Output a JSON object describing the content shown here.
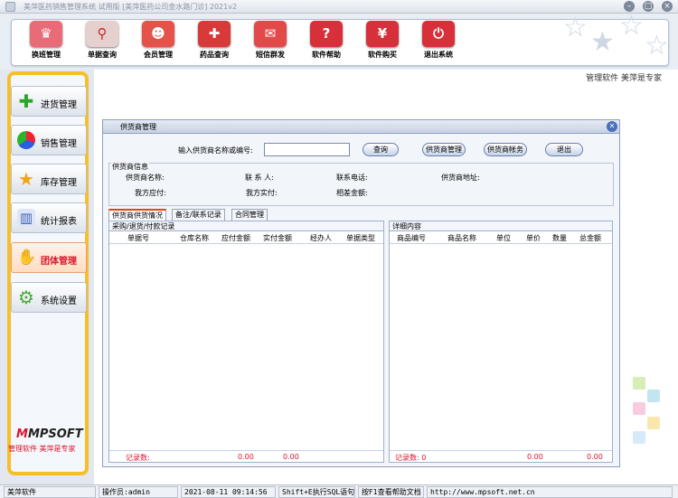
{
  "window": {
    "title": "美萍医药销售管理系统 试用版 [美萍医药公司金水路门诊] 2021v2",
    "controls": [
      "minimize-icon",
      "maximize-icon",
      "close-icon"
    ]
  },
  "toolbar": {
    "buttons": [
      {
        "label": "换班管理",
        "icon": "handover-icon",
        "color": "#e86b77"
      },
      {
        "label": "单据查询",
        "icon": "search-icon",
        "color": "#e6cfcf"
      },
      {
        "label": "会员管理",
        "icon": "member-icon",
        "color": "#e5524a"
      },
      {
        "label": "药品查询",
        "icon": "drug-icon",
        "color": "#d83a3a"
      },
      {
        "label": "短信群发",
        "icon": "sms-icon",
        "color": "#e24a4a"
      },
      {
        "label": "软件帮助",
        "icon": "help-icon",
        "color": "#d8303a"
      },
      {
        "label": "软件购买",
        "icon": "buy-icon",
        "color": "#d8303a"
      },
      {
        "label": "退出系统",
        "icon": "power-icon",
        "color": "#d8303a"
      }
    ]
  },
  "sidebar": {
    "items": [
      {
        "label": "进货管理",
        "icon": "plus-icon",
        "active": false
      },
      {
        "label": "销售管理",
        "icon": "pie-chart-icon",
        "active": false
      },
      {
        "label": "库存管理",
        "icon": "star-icon",
        "active": false
      },
      {
        "label": "统计报表",
        "icon": "bar-chart-icon",
        "active": false
      },
      {
        "label": "团体管理",
        "icon": "handshake-icon",
        "active": true
      },
      {
        "label": "系统设置",
        "icon": "gear-icon",
        "active": false
      }
    ],
    "brand_logo": "MPSOFT",
    "brand_tagline": "管理软件  美萍是专家"
  },
  "main": {
    "slogan": "管理软件  美萍是专家"
  },
  "dialog": {
    "title": "供货商管理",
    "search_label": "输入供货商名称或编号:",
    "search_value": "",
    "buttons": {
      "query": "查询",
      "supplier_mgmt": "供货商管理",
      "supplier_account": "供货商帐务",
      "exit": "退出"
    },
    "info": {
      "group_label": "供货商信息",
      "name_label": "供货商名称:",
      "contact_label": "联  系  人:",
      "phone_label": "联系电话:",
      "address_label": "供货商地址:",
      "payable_label": "我方应付:",
      "paid_label": "我方实付:",
      "diff_label": "相差金额:"
    },
    "tabs": [
      {
        "label": "供货商供货情况",
        "active": true
      },
      {
        "label": "备注/联系记录",
        "active": false
      },
      {
        "label": "合同管理",
        "active": false
      }
    ],
    "left_grid": {
      "title": "采购/退货/付款记录",
      "columns": [
        "单据号",
        "仓库名称",
        "应付金额",
        "实付金额",
        "经办人",
        "单据类型"
      ],
      "rows": [],
      "footer_label": "记录数:",
      "footer_total1": "0.00",
      "footer_total2": "0.00"
    },
    "right_grid": {
      "title": "详细内容",
      "columns": [
        "商品编号",
        "商品名称",
        "单位",
        "单价",
        "数量",
        "总金额"
      ],
      "rows": [],
      "footer_label": "记录数: 0",
      "footer_total1": "0.00",
      "footer_total2": "0.00"
    }
  },
  "statusbar": {
    "app_name": "美萍软件",
    "operator": "操作员:admin",
    "datetime": "2021-08-11 09:14:56",
    "sql_hint": "Shift+E执行SQL语句",
    "help_hint": "按F1查看帮助文档",
    "url": "http://www.mpsoft.net.cn"
  }
}
